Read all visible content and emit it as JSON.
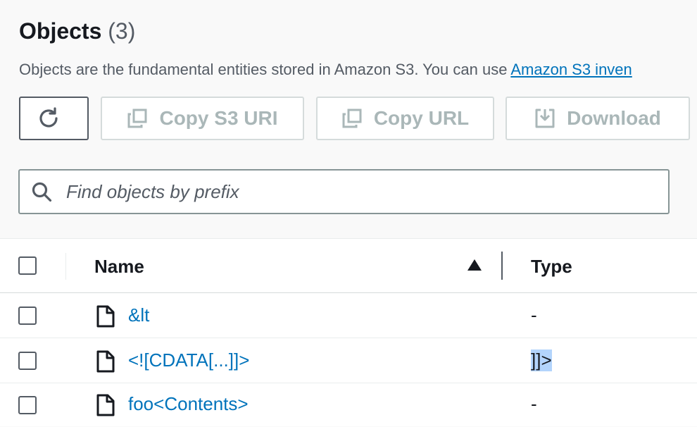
{
  "header": {
    "title": "Objects",
    "count": "(3)",
    "description": "Objects are the fundamental entities stored in Amazon S3. You can use ",
    "description_link": "Amazon S3 inven"
  },
  "toolbar": {
    "refresh_icon": "refresh-icon",
    "copy_s3_uri_label": "Copy S3 URI",
    "copy_url_label": "Copy URL",
    "download_label": "Download"
  },
  "search": {
    "placeholder": "Find objects by prefix",
    "value": ""
  },
  "table": {
    "columns": [
      "Name",
      "Type"
    ],
    "sort": "ascending",
    "rows": [
      {
        "name": "&lt",
        "type": "-"
      },
      {
        "name": "<![CDATA[...]]>",
        "type": "]]>"
      },
      {
        "name": "foo<Contents>",
        "type": "-"
      }
    ]
  },
  "colors": {
    "link": "#0073bb",
    "disabled_text": "#aab7b8",
    "selection": "#b3d4fc"
  }
}
